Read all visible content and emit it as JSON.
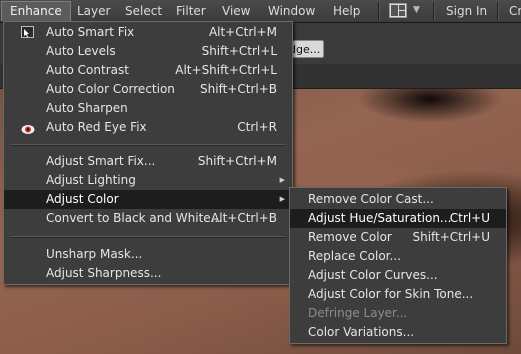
{
  "menubar": {
    "items": [
      "Enhance",
      "Layer",
      "Select",
      "Filter",
      "View",
      "Window",
      "Help"
    ],
    "sign_in": "Sign In",
    "right_cut": "Cr"
  },
  "background": {
    "button_label": "dge..."
  },
  "enhance_menu": {
    "items": [
      {
        "label": "Auto Smart Fix",
        "shortcut": "Alt+Ctrl+M",
        "icon": "auto-smart-fix-icon"
      },
      {
        "label": "Auto Levels",
        "shortcut": "Shift+Ctrl+L"
      },
      {
        "label": "Auto Contrast",
        "shortcut": "Alt+Shift+Ctrl+L"
      },
      {
        "label": "Auto Color Correction",
        "shortcut": "Shift+Ctrl+B"
      },
      {
        "label": "Auto Sharpen",
        "shortcut": ""
      },
      {
        "label": "Auto Red Eye Fix",
        "shortcut": "Ctrl+R",
        "icon": "red-eye-icon"
      },
      {
        "label": "Adjust Smart Fix...",
        "shortcut": "Shift+Ctrl+M"
      },
      {
        "label": "Adjust Lighting",
        "shortcut": "",
        "submenu": true
      },
      {
        "label": "Adjust Color",
        "shortcut": "",
        "submenu": true,
        "highlighted": true
      },
      {
        "label": "Convert to Black and White...",
        "shortcut": "Alt+Ctrl+B"
      },
      {
        "label": "Unsharp Mask...",
        "shortcut": ""
      },
      {
        "label": "Adjust Sharpness...",
        "shortcut": ""
      }
    ]
  },
  "adjust_color_menu": {
    "items": [
      {
        "label": "Remove Color Cast...",
        "shortcut": ""
      },
      {
        "label": "Adjust Hue/Saturation...",
        "shortcut": "Ctrl+U",
        "highlighted": true
      },
      {
        "label": "Remove Color",
        "shortcut": "Shift+Ctrl+U"
      },
      {
        "label": "Replace Color...",
        "shortcut": ""
      },
      {
        "label": "Adjust Color Curves...",
        "shortcut": ""
      },
      {
        "label": "Adjust Color for Skin Tone...",
        "shortcut": ""
      },
      {
        "label": "Defringe Layer...",
        "shortcut": "",
        "disabled": true
      },
      {
        "label": "Color Variations...",
        "shortcut": ""
      }
    ]
  },
  "colors": {
    "menu_bg": "#3d3d3d",
    "highlight_bg": "#1d1d1d",
    "text": "#e6e6e6",
    "disabled_text": "#8c8c8c",
    "red_eye": "#c0392b"
  }
}
